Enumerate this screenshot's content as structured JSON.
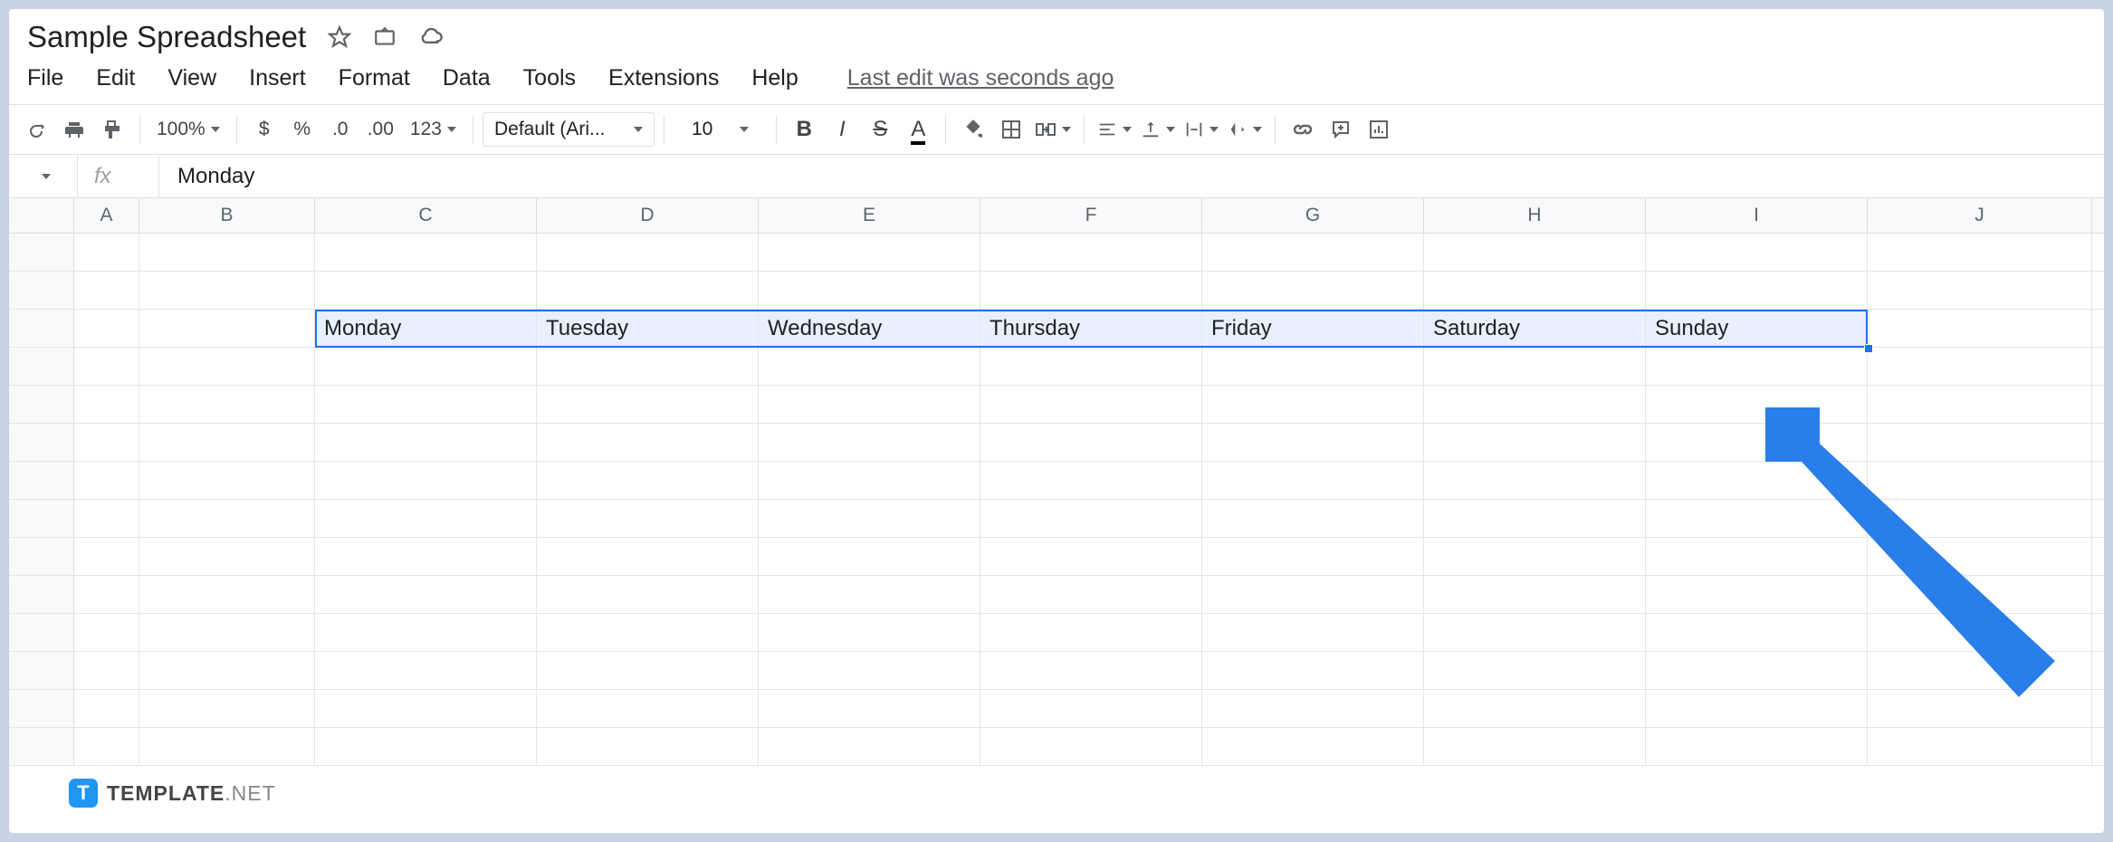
{
  "doc_title": "Sample Spreadsheet",
  "menus": [
    "File",
    "Edit",
    "View",
    "Insert",
    "Format",
    "Data",
    "Tools",
    "Extensions",
    "Help"
  ],
  "last_edit": "Last edit was seconds ago",
  "toolbar": {
    "zoom": "100%",
    "currency": "$",
    "percent": "%",
    "dec_less": ".0",
    "dec_more": ".00",
    "more_formats": "123",
    "font": "Default (Ari...",
    "font_size": "10",
    "bold": "B",
    "italic": "I",
    "strike": "S",
    "text_color": "A"
  },
  "formula": {
    "fx": "fx",
    "value": "Monday"
  },
  "columns": [
    "A",
    "B",
    "C",
    "D",
    "E",
    "F",
    "G",
    "H",
    "I",
    "J"
  ],
  "data_row": [
    "Monday",
    "Tuesday",
    "Wednesday",
    "Thursday",
    "Friday",
    "Saturday",
    "Sunday"
  ],
  "watermark": {
    "badge": "T",
    "bold": "TEMPLATE",
    "light": ".NET"
  }
}
